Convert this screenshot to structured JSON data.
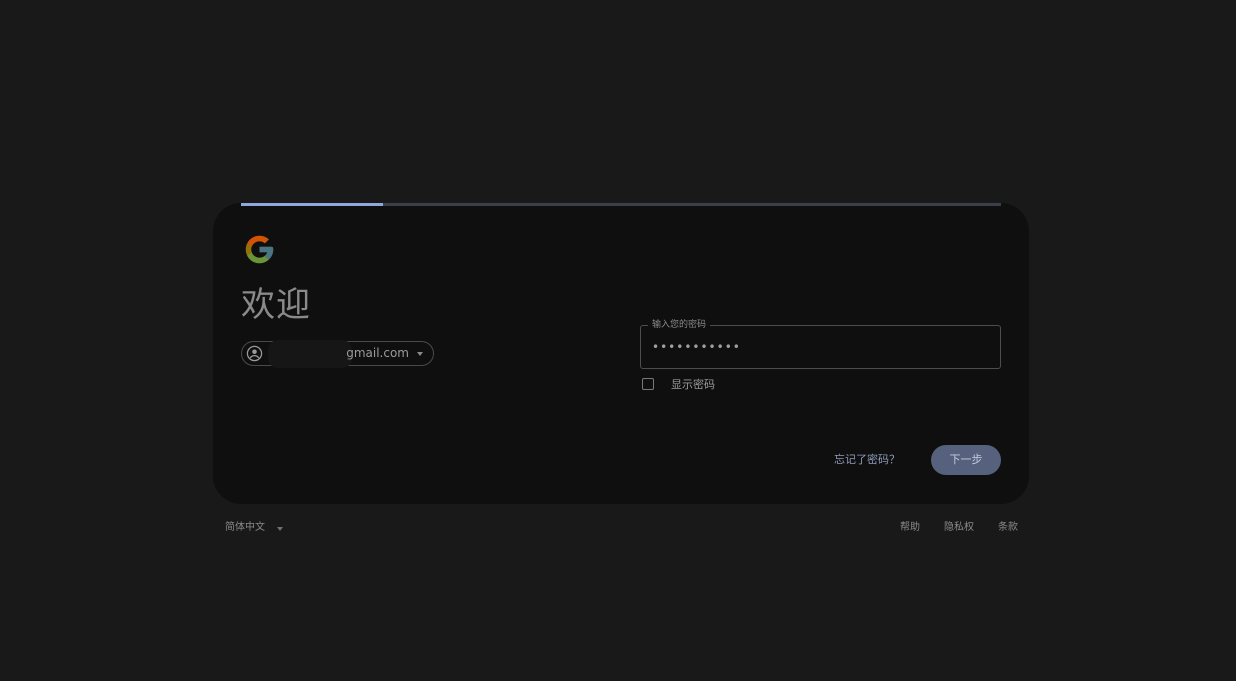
{
  "progress": {
    "fraction": 0.187
  },
  "header": {
    "title": "欢迎"
  },
  "account": {
    "email": "gmail.com",
    "icon": "account-circle-icon"
  },
  "password_field": {
    "label": "输入您的密码",
    "masked_value": "•••••••••••"
  },
  "show_password": {
    "label": "显示密码",
    "checked": false
  },
  "actions": {
    "forgot": "忘记了密码？",
    "next": "下一步"
  },
  "footer": {
    "language": "简体中文",
    "help": "帮助",
    "privacy": "隐私权",
    "terms": "条款"
  },
  "colors": {
    "accent": "#8fa6df",
    "button_bg": "#56617d",
    "background": "#191919",
    "card": "#0f0f0f"
  }
}
